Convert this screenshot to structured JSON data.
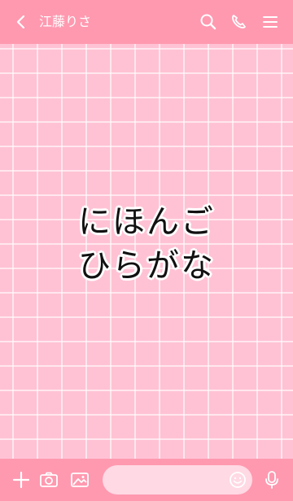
{
  "header": {
    "title": "江藤りさ",
    "icons": [
      "back-icon",
      "search-icon",
      "phone-icon",
      "menu-icon"
    ]
  },
  "content": {
    "line1": "にほんご",
    "line2": "ひらがな"
  },
  "footer": {
    "icons": [
      "add-icon",
      "camera-icon",
      "image-icon",
      "emoji-icon",
      "mic-icon"
    ],
    "input_placeholder": ""
  },
  "colors": {
    "bar": "#ff99b0",
    "background": "#ffc2d4",
    "grid": "#ffffff"
  }
}
